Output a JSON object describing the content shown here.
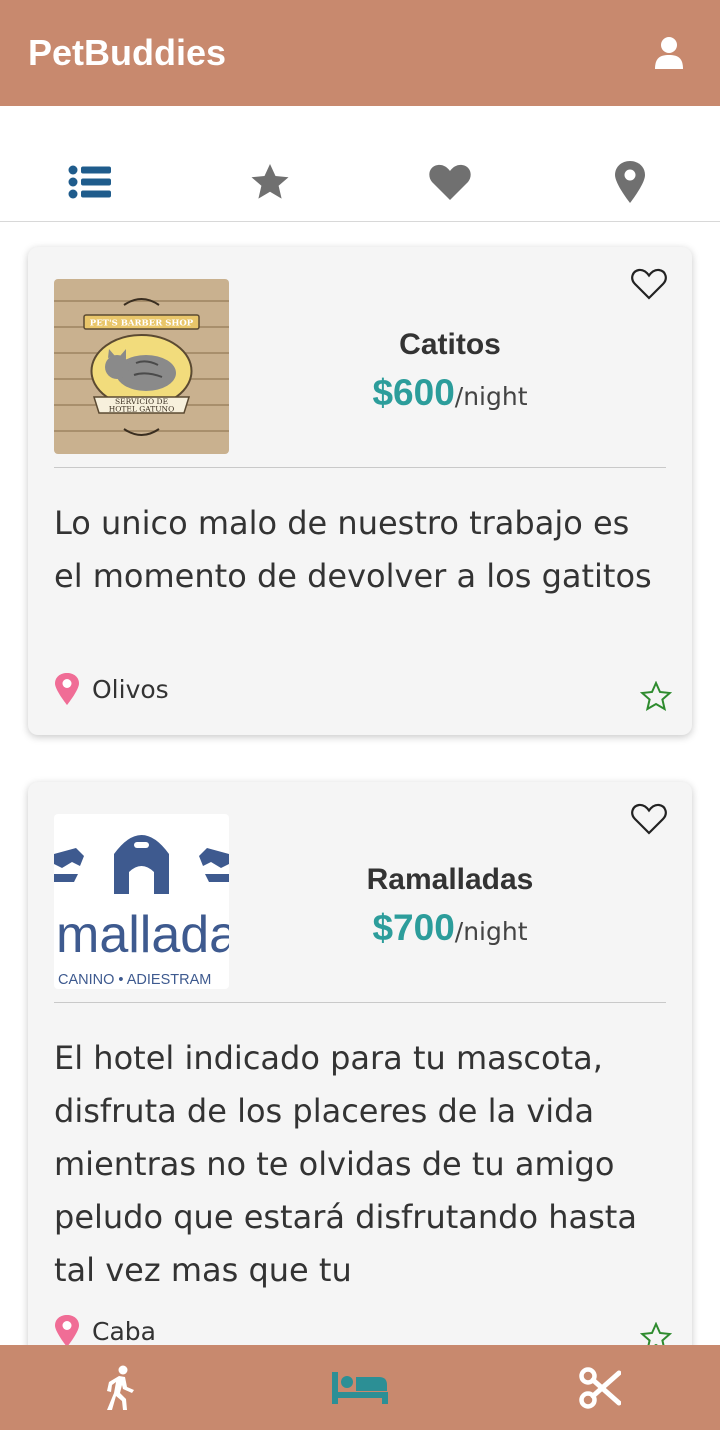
{
  "app": {
    "title": "PetBuddies"
  },
  "header": {
    "profile_icon": "user-icon"
  },
  "tabs": [
    {
      "id": "list",
      "icon": "list-icon",
      "active": true
    },
    {
      "id": "top-rated",
      "icon": "star-icon",
      "active": false
    },
    {
      "id": "favorites",
      "icon": "heart-icon",
      "active": false
    },
    {
      "id": "nearby",
      "icon": "map-marker-icon",
      "active": false
    }
  ],
  "listings": [
    {
      "name": "Catitos",
      "price": "$600",
      "unit": "/night",
      "description": "Lo unico malo de nuestro trabajo es el momento de devolver a los gatitos",
      "location": "Olivos",
      "logo_text": [
        "PET'S BARBER SHOP",
        "SERVICIO DE",
        "HOTEL GATUNO"
      ]
    },
    {
      "name": "Ramalladas",
      "price": "$700",
      "unit": "/night",
      "description": "El hotel indicado para tu mascota, disfruta de los placeres de la vida mientras no te olvidas de tu amigo peludo que estará disfrutando hasta tal vez mas que tu",
      "location": "Caba",
      "logo_text": [
        "mallada",
        "CANINO • ADIESTRAM"
      ]
    }
  ],
  "bottom_nav": [
    {
      "id": "walkers",
      "icon": "walking-icon",
      "active": false
    },
    {
      "id": "hotels",
      "icon": "bed-icon",
      "active": true
    },
    {
      "id": "grooming",
      "icon": "scissors-icon",
      "active": false
    }
  ],
  "colors": {
    "brand": "#c8896e",
    "price": "#2c9d9b",
    "active_tab": "#1f5c8c",
    "inactive_icon": "#707070",
    "location_pin": "#f06d96",
    "rating_star": "#2e8b2e",
    "active_nav": "#2c8f95"
  }
}
